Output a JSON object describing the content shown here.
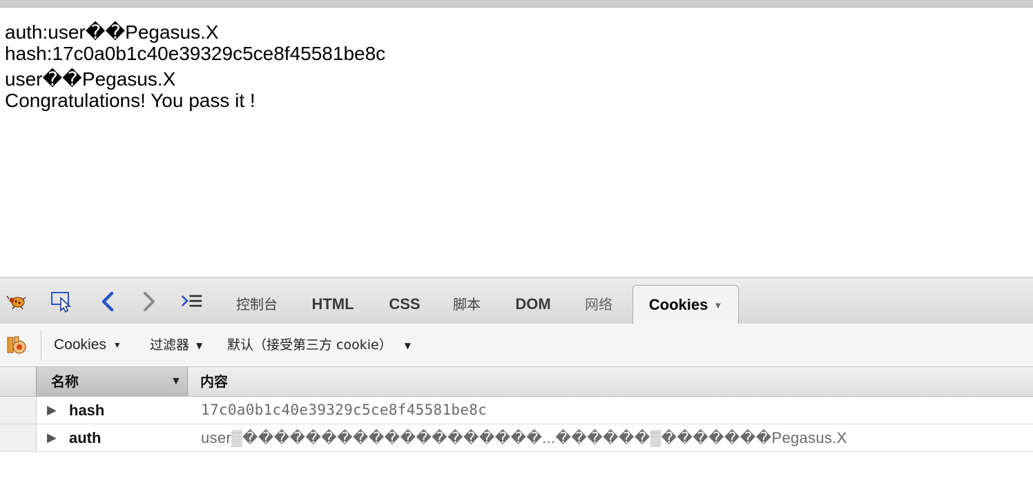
{
  "page": {
    "lines": [
      "auth:user��Pegasus.X",
      "hash:17c0a0b1c40e39329c5ce8f45581be8c",
      "user��Pegasus.X",
      "Congratulations! You pass it !"
    ]
  },
  "devtools": {
    "toolbar": {
      "icons": [
        "firebug-icon",
        "inspect-icon",
        "back-icon",
        "forward-icon",
        "command-line-icon"
      ],
      "tabs": [
        "控制台",
        "HTML",
        "CSS",
        "脚本",
        "DOM",
        "网络",
        "Cookies"
      ],
      "active_tab": "Cookies"
    },
    "subbar": {
      "cookies_menu": "Cookies",
      "filter_menu": "过滤器",
      "policy_menu": "默认（接受第三方 cookie）"
    },
    "table": {
      "columns": [
        "名称",
        "内容"
      ],
      "rows": [
        {
          "name": "hash",
          "value": "17c0a0b1c40e39329c5ce8f45581be8c"
        },
        {
          "name": "auth",
          "value": "user▒�������������������...������▒�������Pegasus.X"
        }
      ]
    },
    "colors": {
      "back_arrow": "#2a56c6",
      "forward_arrow": "#8a8a8a"
    }
  }
}
